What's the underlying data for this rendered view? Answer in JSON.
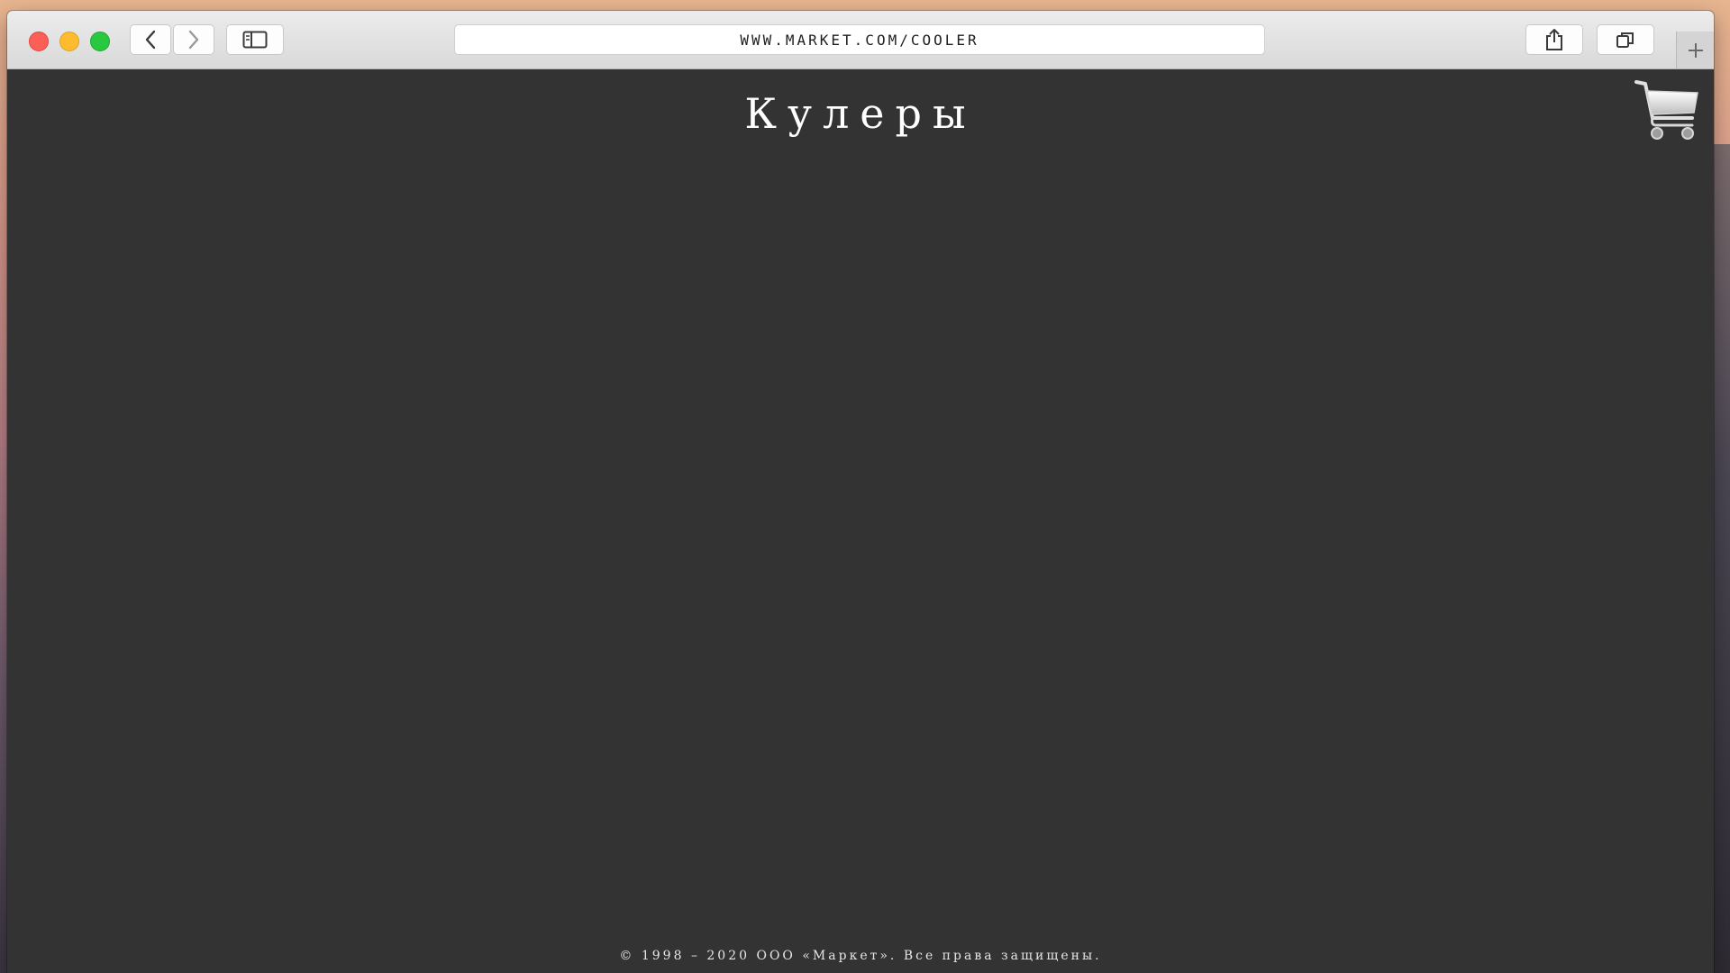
{
  "browser": {
    "address_url": "WWW.MARKET.COM/COOLER",
    "buttons": {
      "back_icon": "chevron-left-icon",
      "forward_icon": "chevron-right-icon",
      "sidebar_icon": "sidebar-icon",
      "share_icon": "share-icon",
      "tabs_icon": "tabs-icon",
      "new_tab_icon": "plus-icon"
    }
  },
  "page": {
    "title": "Кулеры",
    "cart_icon": "shopping-cart-icon",
    "footer": "© 1998 – 2020 ООО «Маркет». Все права защищены."
  },
  "colors": {
    "page_background": "#333333",
    "title_text": "#ffffff",
    "close": "#fc5f57",
    "minimize": "#fdbc2e",
    "maximize": "#28c840"
  }
}
